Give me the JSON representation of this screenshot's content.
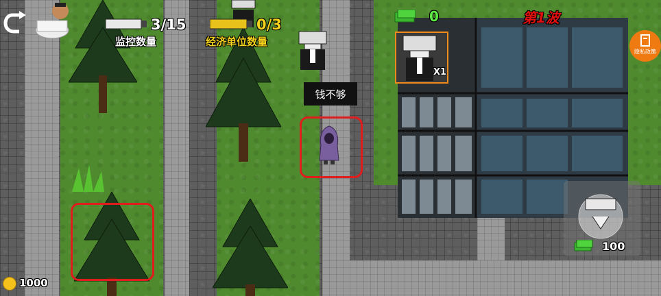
{
  "hud": {
    "camera_count": "3/15",
    "camera_label": "监控数量",
    "economy_count": "0/3",
    "economy_label": "经济单位数量",
    "money_count": "0",
    "wave_label": "第1波",
    "privacy_label": "隐私政策",
    "gold": "1000",
    "card_count": "X1",
    "unit_cost": "100"
  },
  "tooltip": {
    "text": "钱不够"
  },
  "colors": {
    "grass": "#4f8a2f",
    "path": "#9a9a9a",
    "highlight": "#e01c1c",
    "wave": "#e01010",
    "card_border": "#f08a1a",
    "privacy": "#f07a12"
  }
}
